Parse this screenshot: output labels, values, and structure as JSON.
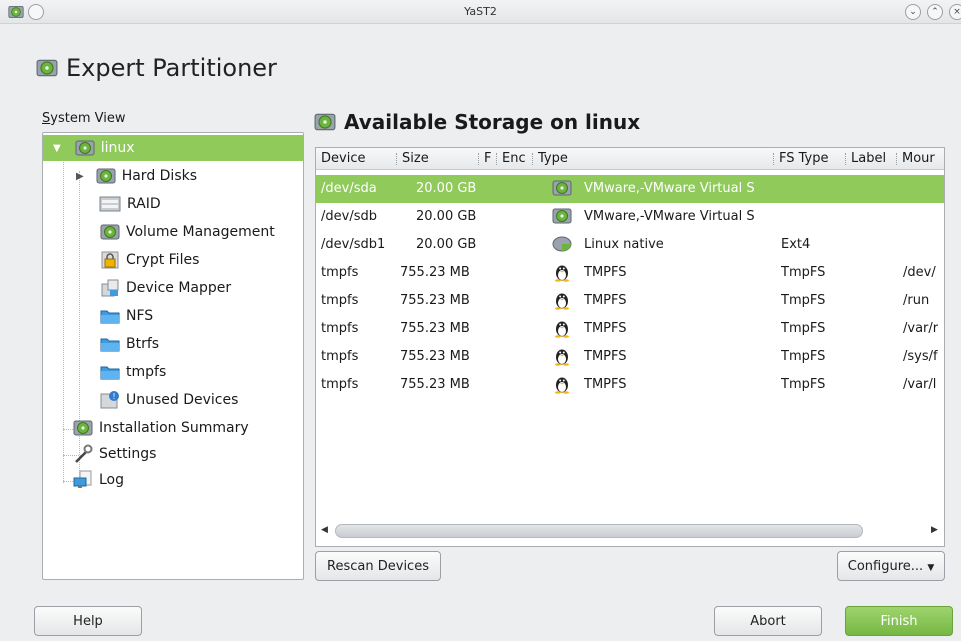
{
  "window": {
    "title": "YaST2"
  },
  "page": {
    "title": "Expert Partitioner"
  },
  "system_view": {
    "label": "System View",
    "items": [
      {
        "label": "linux",
        "icon": "hard-disk-icon"
      },
      {
        "label": "Hard Disks",
        "icon": "hard-disk-icon"
      },
      {
        "label": "RAID",
        "icon": "raid-icon"
      },
      {
        "label": "Volume Management",
        "icon": "hard-disk-icon"
      },
      {
        "label": "Crypt Files",
        "icon": "lock-icon"
      },
      {
        "label": "Device Mapper",
        "icon": "device-mapper-icon"
      },
      {
        "label": "NFS",
        "icon": "folder-icon"
      },
      {
        "label": "Btrfs",
        "icon": "folder-icon"
      },
      {
        "label": "tmpfs",
        "icon": "folder-icon"
      },
      {
        "label": "Unused Devices",
        "icon": "unused-devices-icon"
      },
      {
        "label": "Installation Summary",
        "icon": "hard-disk-icon"
      },
      {
        "label": "Settings",
        "icon": "wrench-icon"
      },
      {
        "label": "Log",
        "icon": "monitor-icon"
      }
    ]
  },
  "storage": {
    "title": "Available Storage on linux",
    "columns": [
      "Device",
      "Size",
      "F",
      "Enc",
      "Type",
      "FS Type",
      "Label",
      "Mour"
    ],
    "rows": [
      {
        "device": "/dev/sda",
        "size": "20.00 GB",
        "type": "VMware,-VMware Virtual S",
        "fs_type": "",
        "mount": "",
        "icon": "hard-disk-icon"
      },
      {
        "device": "/dev/sdb",
        "size": "20.00 GB",
        "type": "VMware,-VMware Virtual S",
        "fs_type": "",
        "mount": "",
        "icon": "hard-disk-icon"
      },
      {
        "device": "/dev/sdb1",
        "size": "20.00 GB",
        "type": "Linux native",
        "fs_type": "Ext4",
        "mount": "",
        "icon": "partition-icon"
      },
      {
        "device": "tmpfs",
        "size": "755.23 MB",
        "type": "TMPFS",
        "fs_type": "TmpFS",
        "mount": "/dev/",
        "icon": "tux-icon"
      },
      {
        "device": "tmpfs",
        "size": "755.23 MB",
        "type": "TMPFS",
        "fs_type": "TmpFS",
        "mount": "/run",
        "icon": "tux-icon"
      },
      {
        "device": "tmpfs",
        "size": "755.23 MB",
        "type": "TMPFS",
        "fs_type": "TmpFS",
        "mount": "/var/r",
        "icon": "tux-icon"
      },
      {
        "device": "tmpfs",
        "size": "755.23 MB",
        "type": "TMPFS",
        "fs_type": "TmpFS",
        "mount": "/sys/f",
        "icon": "tux-icon"
      },
      {
        "device": "tmpfs",
        "size": "755.23 MB",
        "type": "TMPFS",
        "fs_type": "TmpFS",
        "mount": "/var/l",
        "icon": "tux-icon"
      }
    ],
    "rescan_label": "Rescan Devices",
    "configure_label": "Configure..."
  },
  "footer": {
    "help": "Help",
    "abort": "Abort",
    "finish": "Finish"
  },
  "colors": {
    "selection": "#8fca5a",
    "finish": "#83c24f"
  }
}
